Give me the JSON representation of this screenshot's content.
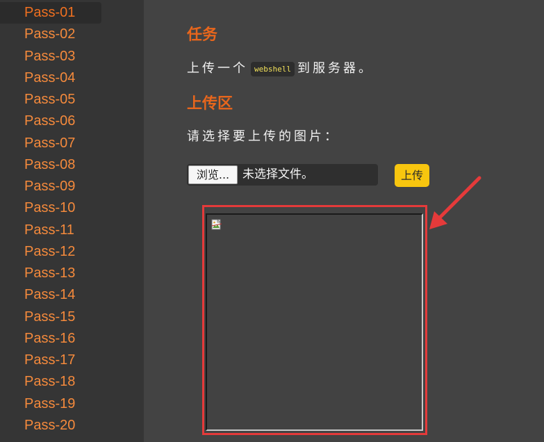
{
  "sidebar": {
    "items": [
      {
        "label": "Pass-01",
        "active": true
      },
      {
        "label": "Pass-02"
      },
      {
        "label": "Pass-03"
      },
      {
        "label": "Pass-04"
      },
      {
        "label": "Pass-05"
      },
      {
        "label": "Pass-06"
      },
      {
        "label": "Pass-07"
      },
      {
        "label": "Pass-08"
      },
      {
        "label": "Pass-09"
      },
      {
        "label": "Pass-10"
      },
      {
        "label": "Pass-11"
      },
      {
        "label": "Pass-12"
      },
      {
        "label": "Pass-13"
      },
      {
        "label": "Pass-14"
      },
      {
        "label": "Pass-15"
      },
      {
        "label": "Pass-16"
      },
      {
        "label": "Pass-17"
      },
      {
        "label": "Pass-18"
      },
      {
        "label": "Pass-19"
      },
      {
        "label": "Pass-20"
      }
    ]
  },
  "task": {
    "heading": "任务",
    "text_before": "上传一个",
    "code": "webshell",
    "text_after": "到服务器。"
  },
  "upload": {
    "heading": "上传区",
    "prompt": "请选择要上传的图片：",
    "browse_label": "浏览...",
    "file_status": "未选择文件。",
    "submit_label": "上传"
  },
  "colors": {
    "accent": "#e8661c",
    "sidebar_text": "#f58a3c",
    "button": "#f8c60f",
    "highlight": "#e53a3a"
  },
  "icons": {
    "preview": "broken-image-icon",
    "annotation": "red-arrow-icon"
  }
}
